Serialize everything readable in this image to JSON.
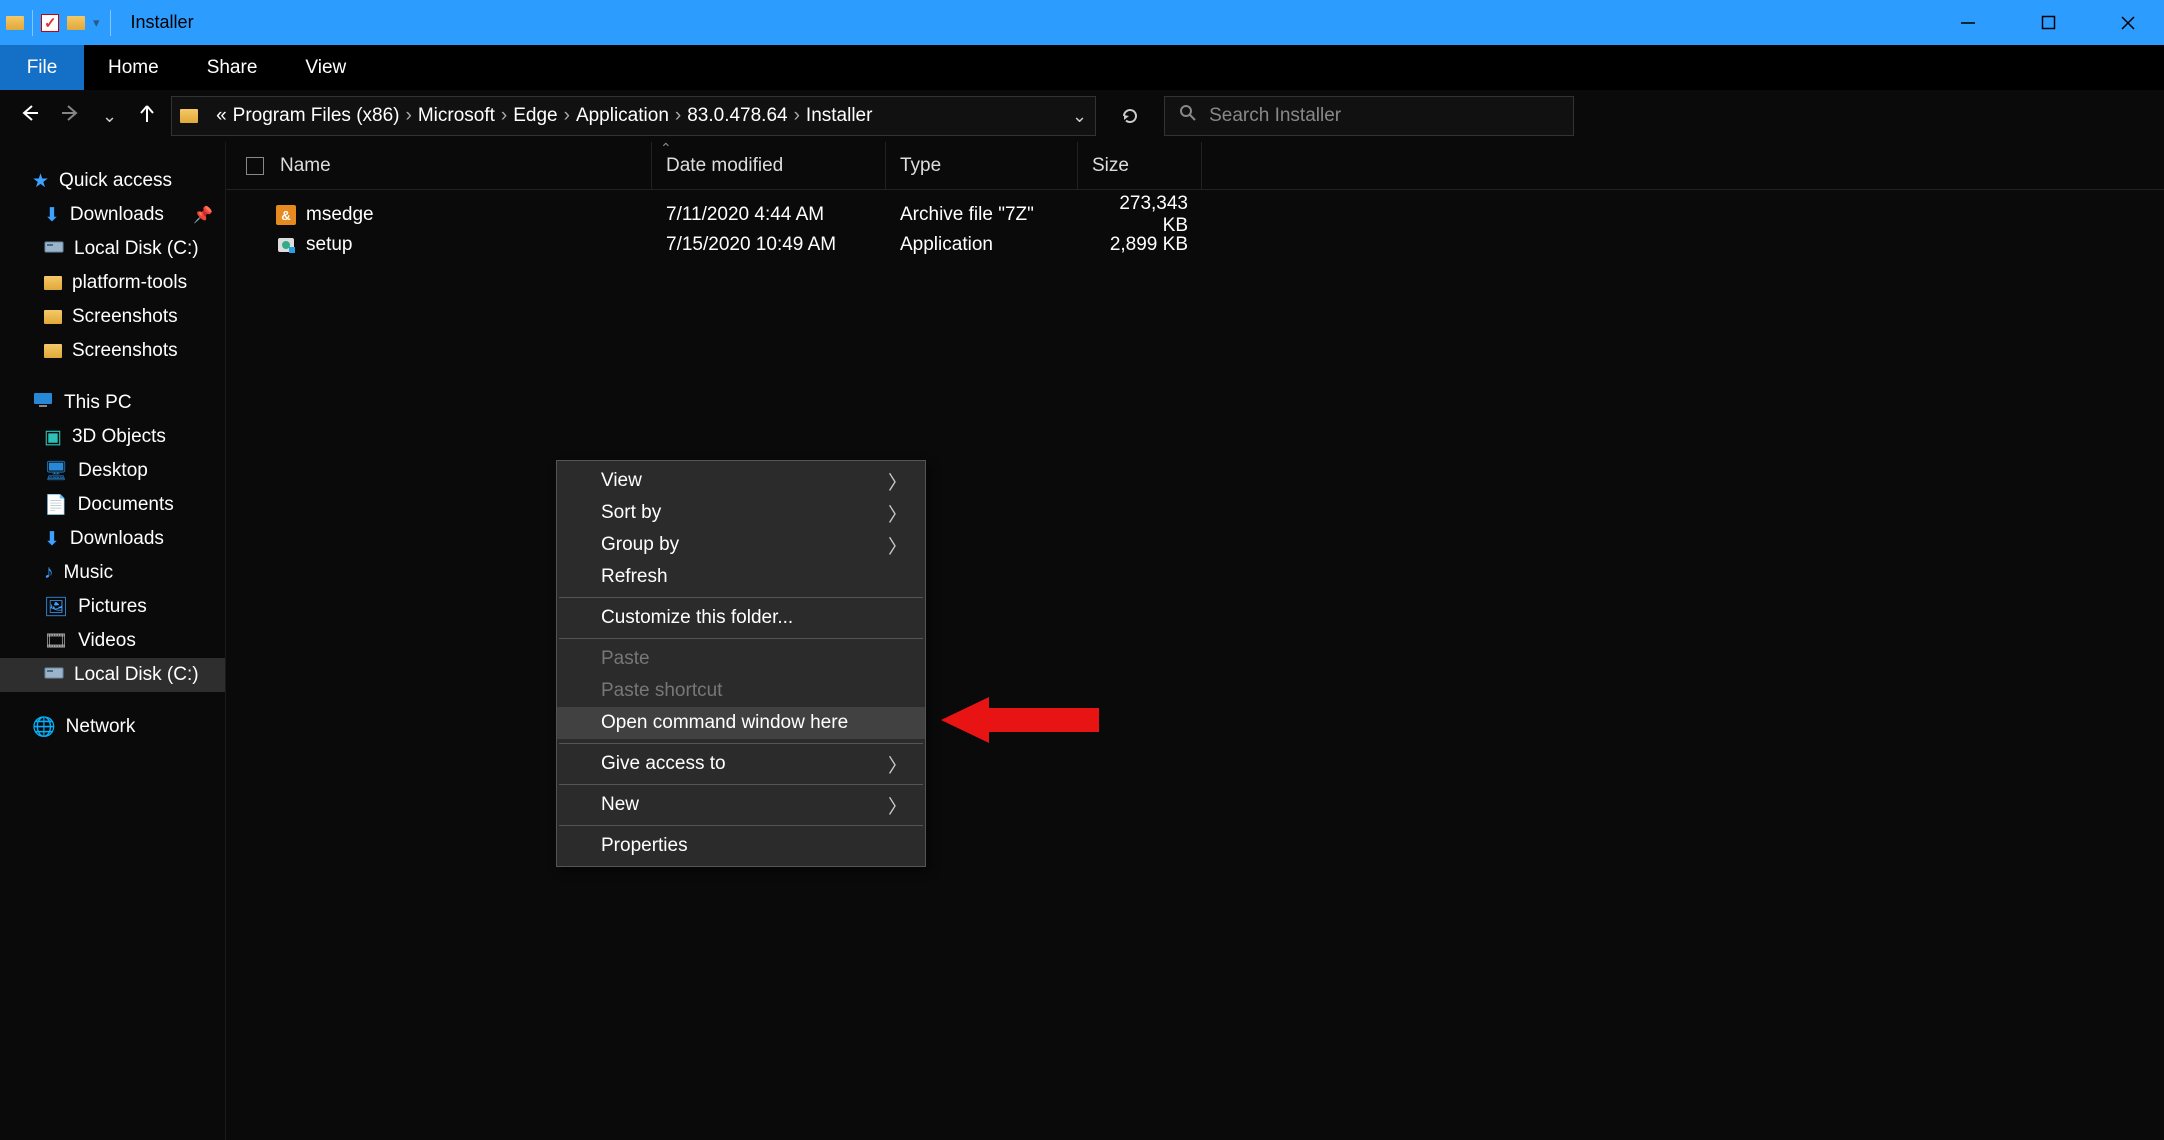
{
  "title": "Installer",
  "ribbon": {
    "file": "File",
    "home": "Home",
    "share": "Share",
    "view": "View"
  },
  "breadcrumb": {
    "prefix": "«",
    "items": [
      "Program Files (x86)",
      "Microsoft",
      "Edge",
      "Application",
      "83.0.478.64",
      "Installer"
    ]
  },
  "search": {
    "placeholder": "Search Installer"
  },
  "sidebar": {
    "quick_access": "Quick access",
    "quick_items": [
      {
        "label": "Downloads",
        "icon": "download",
        "pinned": true
      },
      {
        "label": "Local Disk (C:)",
        "icon": "disk"
      },
      {
        "label": "platform-tools",
        "icon": "folder"
      },
      {
        "label": "Screenshots",
        "icon": "folder"
      },
      {
        "label": "Screenshots",
        "icon": "folder"
      }
    ],
    "this_pc": "This PC",
    "pc_items": [
      {
        "label": "3D Objects",
        "icon": "3d"
      },
      {
        "label": "Desktop",
        "icon": "desktop"
      },
      {
        "label": "Documents",
        "icon": "docs"
      },
      {
        "label": "Downloads",
        "icon": "download"
      },
      {
        "label": "Music",
        "icon": "music"
      },
      {
        "label": "Pictures",
        "icon": "pictures"
      },
      {
        "label": "Videos",
        "icon": "videos"
      },
      {
        "label": "Local Disk (C:)",
        "icon": "disk",
        "selected": true
      }
    ],
    "network": "Network"
  },
  "columns": {
    "name": "Name",
    "date": "Date modified",
    "type": "Type",
    "size": "Size"
  },
  "files": [
    {
      "name": "msedge",
      "date": "7/11/2020 4:44 AM",
      "type": "Archive file \"7Z\"",
      "size": "273,343 KB",
      "icon": "archive"
    },
    {
      "name": "setup",
      "date": "7/15/2020 10:49 AM",
      "type": "Application",
      "size": "2,899 KB",
      "icon": "app"
    }
  ],
  "context_menu": {
    "items": [
      {
        "label": "View",
        "submenu": true
      },
      {
        "label": "Sort by",
        "submenu": true
      },
      {
        "label": "Group by",
        "submenu": true
      },
      {
        "label": "Refresh"
      },
      {
        "sep": true
      },
      {
        "label": "Customize this folder..."
      },
      {
        "sep": true
      },
      {
        "label": "Paste",
        "disabled": true
      },
      {
        "label": "Paste shortcut",
        "disabled": true
      },
      {
        "label": "Open command window here",
        "hover": true
      },
      {
        "sep": true
      },
      {
        "label": "Give access to",
        "submenu": true
      },
      {
        "sep": true
      },
      {
        "label": "New",
        "submenu": true
      },
      {
        "sep": true
      },
      {
        "label": "Properties"
      }
    ]
  }
}
